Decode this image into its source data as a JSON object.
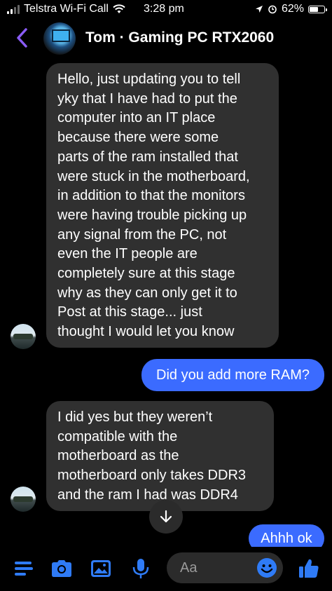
{
  "status_bar": {
    "carrier": "Telstra Wi-Fi Call",
    "time": "3:28 pm",
    "battery": "62%",
    "battery_level": 0.62
  },
  "header": {
    "title": "Tom · Gaming PC RTX2060"
  },
  "messages": [
    {
      "sender": "Tom",
      "direction": "incoming",
      "text": "Hello, just updating you to tell\nyky that I have had to put the\ncomputer into an IT place\nbecause there were some\nparts of the ram installed that\nwere stuck in the motherboard,\nin addition to that the monitors\nwere having trouble picking up\nany signal from the PC, not\neven the IT people are\ncompletely sure at this stage\nwhy as they can only get it to\nPost at this stage... just\nthought I would let you know"
    },
    {
      "sender": "me",
      "direction": "outgoing",
      "text": "Did you add more RAM?"
    },
    {
      "sender": "Tom",
      "direction": "incoming",
      "text": "I did yes but they weren’t\ncompatible with the\nmotherboard as the\nmotherboard only takes DDR3\nand the ram I had was DDR4"
    },
    {
      "sender": "me",
      "direction": "outgoing",
      "text": "Ahhh ok"
    }
  ],
  "composer": {
    "placeholder": "Aa"
  },
  "colors": {
    "accent": "#3b6bff",
    "icon_blue": "#2f7bf6",
    "incoming_bubble": "#303030",
    "back_arrow": "#8a5cf6"
  },
  "icons": [
    "signal-icon",
    "wifi-icon",
    "location-icon",
    "alarm-icon",
    "battery-icon",
    "back-chevron-icon",
    "menu-icon",
    "camera-icon",
    "photo-icon",
    "microphone-icon",
    "emoji-icon",
    "thumbs-up-icon",
    "arrow-down-icon"
  ]
}
